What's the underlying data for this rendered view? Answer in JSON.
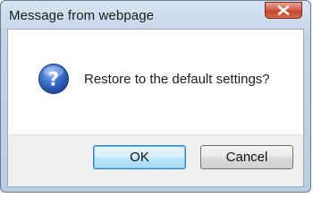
{
  "window": {
    "title": "Message from webpage"
  },
  "dialog": {
    "icon": "question-icon",
    "message": "Restore to the default settings?"
  },
  "buttons": {
    "ok_label": "OK",
    "cancel_label": "Cancel"
  },
  "colors": {
    "frame": "#c3d4e8",
    "close_button": "#c24330",
    "question_icon": "#2a5db4",
    "default_button_border": "#3c7fb1"
  }
}
